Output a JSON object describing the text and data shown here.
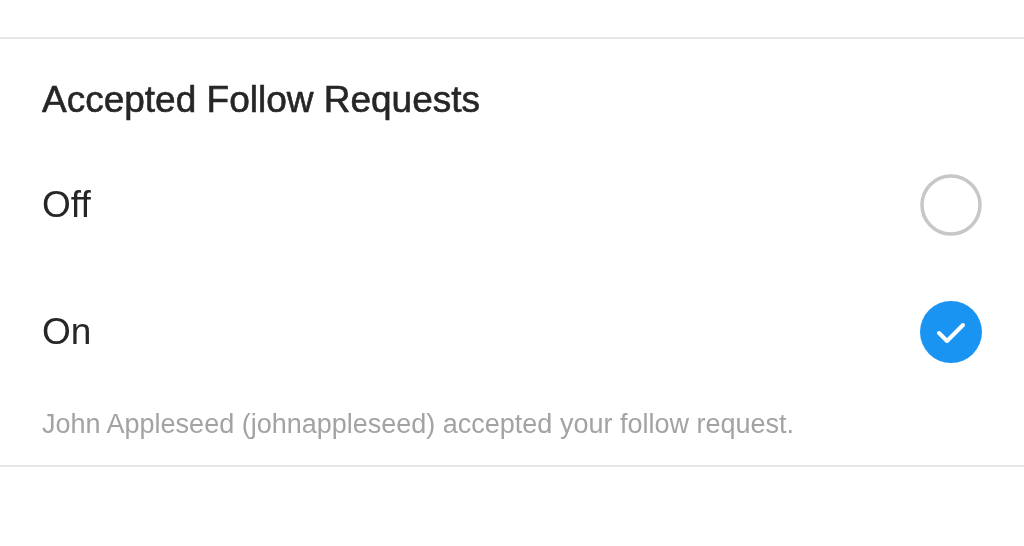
{
  "section": {
    "title": "Accepted Follow Requests",
    "options": [
      {
        "label": "Off",
        "selected": false
      },
      {
        "label": "On",
        "selected": true
      }
    ],
    "preview": "John Appleseed (johnappleseed) accepted your follow request."
  }
}
